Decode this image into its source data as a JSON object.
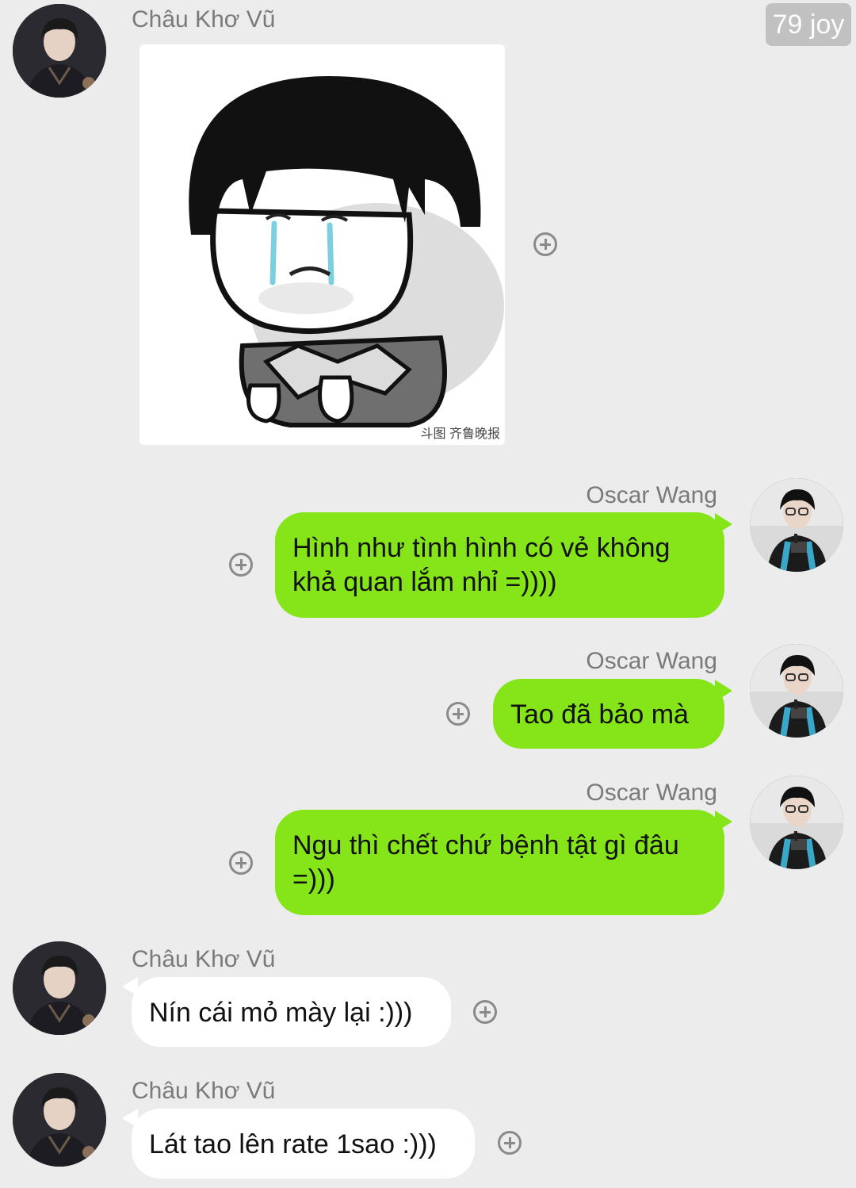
{
  "status_badge": "79 joy",
  "messages": [
    {
      "sender": "Châu Khơ Vũ",
      "type": "sticker",
      "sticker_icon": "crying-mushroom-hair-kid",
      "watermark": "斗图 齐鲁晚报"
    },
    {
      "sender": "Oscar Wang",
      "text_lines": [
        "Hình như tình hình có vẻ không",
        "khả quan lắm nhỉ =))))"
      ]
    },
    {
      "sender": "Oscar Wang",
      "text_lines": [
        "Tao đã bảo mà"
      ]
    },
    {
      "sender": "Oscar Wang",
      "text_lines": [
        "Ngu thì chết chứ bệnh tật gì đâu",
        "=)))"
      ]
    },
    {
      "sender": "Châu Khơ Vũ",
      "text_lines": [
        "Nín cái mỏ mày lại :)))"
      ]
    },
    {
      "sender": "Châu Khơ Vũ",
      "text_lines": [
        "Lát tao lên rate 1sao :)))"
      ]
    }
  ],
  "colors": {
    "background": "#ececec",
    "outgoing_bubble": "#85e519",
    "incoming_bubble": "#ffffff",
    "name_text": "#7a7a7a"
  },
  "icons": [
    "add-circle-icon",
    "avatar-chau-kho-vu",
    "avatar-oscar-wang"
  ]
}
